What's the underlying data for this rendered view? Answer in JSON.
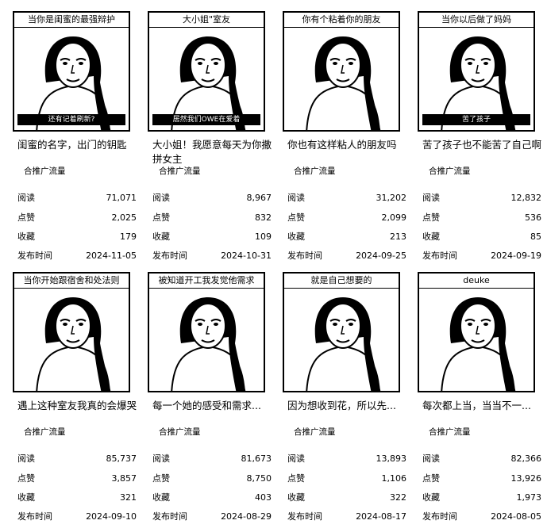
{
  "labels": {
    "read": "阅读",
    "like": "点赞",
    "save": "收藏",
    "date": "发布时间",
    "tag": "合推广流量"
  },
  "cards": [
    {
      "caption": "当你是闺蜜的最强辩护",
      "subtitle": "还有记着刷新?",
      "title": "闺蜜的名字，出门的钥匙",
      "read": "71,071",
      "like": "2,025",
      "save": "179",
      "date": "2024-11-05"
    },
    {
      "caption": "大小姐\"室友",
      "subtitle": "居然我们OWE在爱着",
      "title": "大小姐！我愿意每天为你撒拼女主",
      "read": "8,967",
      "like": "832",
      "save": "109",
      "date": "2024-10-31"
    },
    {
      "caption": "你有个粘着你的朋友",
      "subtitle": "",
      "title": "你也有这样粘人的朋友吗",
      "read": "31,202",
      "like": "2,099",
      "save": "213",
      "date": "2024-09-25"
    },
    {
      "caption": "当你以后做了妈妈",
      "subtitle": "苦了孩子",
      "title": "苦了孩子也不能苦了自己啊",
      "read": "12,832",
      "like": "536",
      "save": "85",
      "date": "2024-09-19"
    },
    {
      "caption": "当你开始跟宿舍和处法则",
      "subtitle": "",
      "title": "遇上这种室友我真的会爆哭",
      "read": "85,737",
      "like": "3,857",
      "save": "321",
      "date": "2024-09-10"
    },
    {
      "caption": "被知道开工我发觉他需求",
      "subtitle": "",
      "title": "每一个她的感受和需求...",
      "read": "81,673",
      "like": "8,750",
      "save": "403",
      "date": "2024-08-29"
    },
    {
      "caption": "就是自己想要的",
      "subtitle": "",
      "title": "因为想收到花，所以先...",
      "read": "13,893",
      "like": "1,106",
      "save": "322",
      "date": "2024-08-17"
    },
    {
      "caption": "deuke",
      "subtitle": "",
      "title": "每次都上当，当当不一...",
      "read": "82,366",
      "like": "13,926",
      "save": "1,973",
      "date": "2024-08-05"
    }
  ]
}
